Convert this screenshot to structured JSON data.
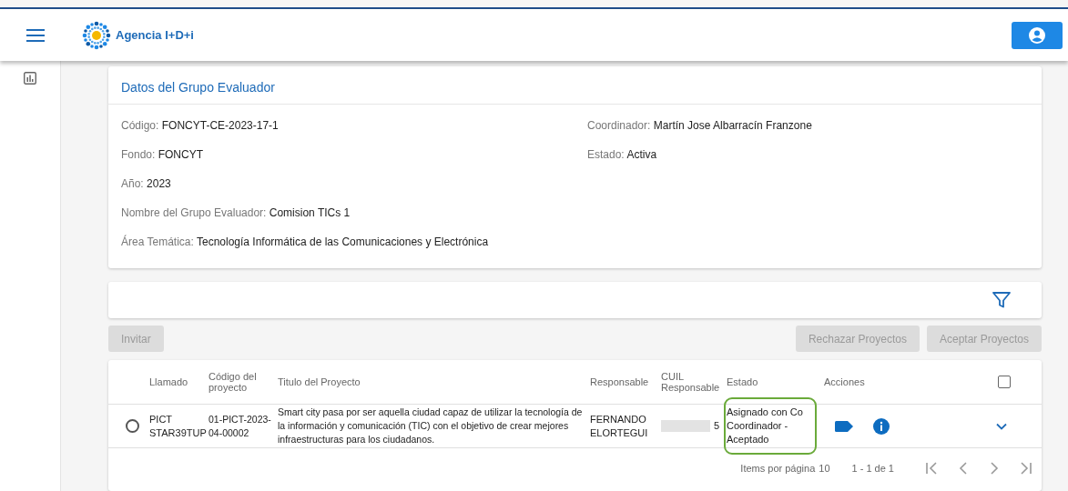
{
  "header": {
    "brand": "Agencia I+D+i"
  },
  "group_card": {
    "title": "Datos del Grupo Evaluador",
    "left_fields": [
      {
        "label": "Código:",
        "value": "FONCYT-CE-2023-17-1"
      },
      {
        "label": "Fondo:",
        "value": "FONCYT"
      },
      {
        "label": "Año:",
        "value": "2023"
      },
      {
        "label": "Nombre del Grupo Evaluador:",
        "value": "Comision TICs 1"
      },
      {
        "label": "Área Temática:",
        "value": "Tecnología Informática de las Comunicaciones y Electrónica"
      }
    ],
    "right_fields": [
      {
        "label": "Coordinador:",
        "value": "Martín Jose Albarracín Franzone"
      },
      {
        "label": "Estado:",
        "value": "Activa"
      }
    ]
  },
  "actions": {
    "left": [
      {
        "label": "Invitar",
        "disabled": true
      }
    ],
    "right": [
      {
        "label": "Rechazar Proyectos",
        "disabled": true
      },
      {
        "label": "Aceptar Proyectos",
        "disabled": true
      }
    ]
  },
  "table": {
    "columns": [
      "Llamado",
      "Código del proyecto",
      "Titulo del Proyecto",
      "Responsable",
      "CUIL Responsable",
      "Estado",
      "Acciones"
    ],
    "select_all_checked": false,
    "rows": [
      {
        "selected": false,
        "llamado": "PICT STAR39TUP",
        "codigo": "01-PICT-2023-04-00002",
        "titulo": "Smart city pasa por ser aquella ciudad capaz de utilizar la tecnología de la información y comunicación (TIC) con el objetivo de crear mejores infraestructuras para los ciudadanos.",
        "responsable": "FERNANDO ELORTEGUI",
        "cuil": "5",
        "estado": "Asignado con Co Coordinador - Aceptado",
        "highlighted": true,
        "expanded": false
      }
    ],
    "paginator": {
      "items_label": "Items por página",
      "page_size": "10",
      "range": "1 - 1 de 1"
    }
  }
}
